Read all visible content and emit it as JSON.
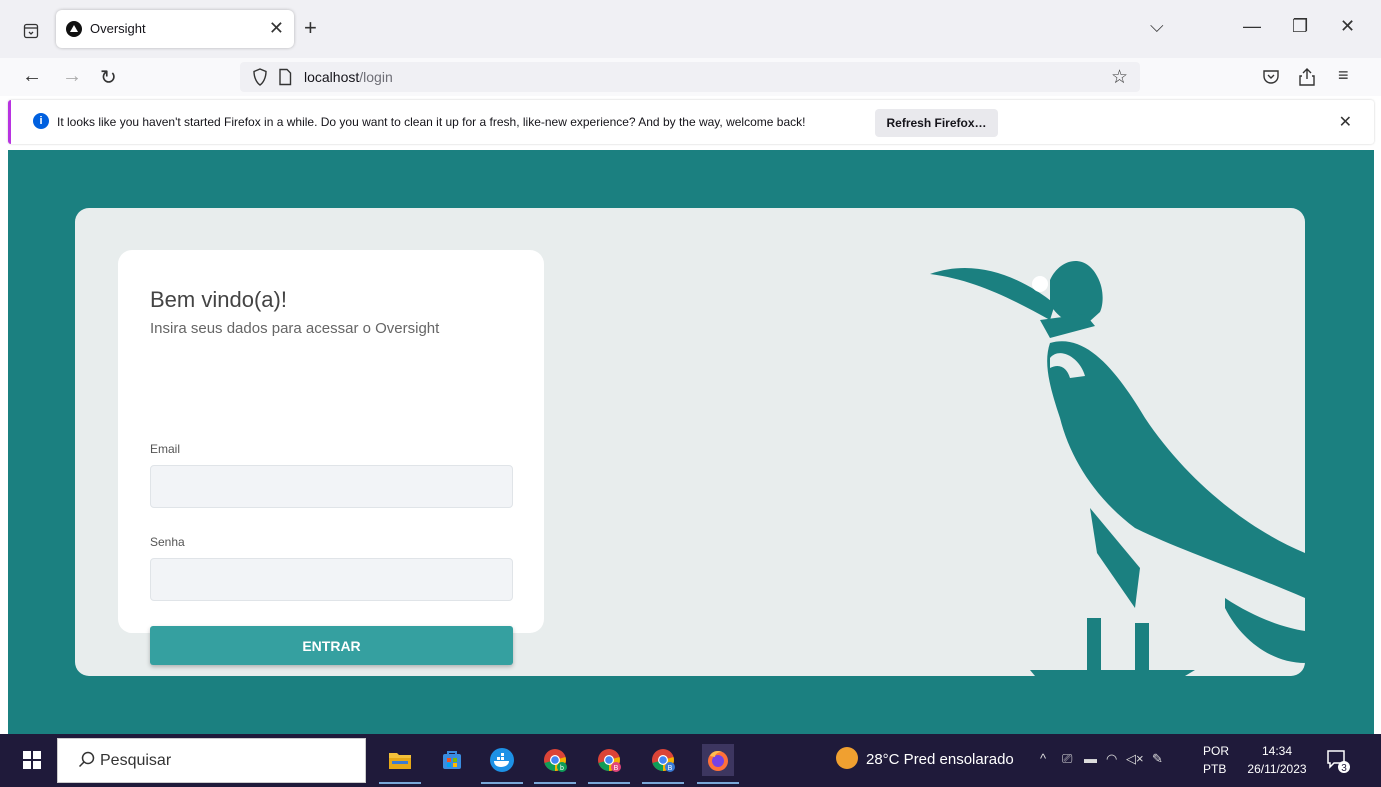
{
  "browser": {
    "tab": {
      "title": "Oversight"
    },
    "url": {
      "host": "localhost",
      "path": "/login"
    },
    "infobar": {
      "message": "It looks like you haven't started Firefox in a while. Do you want to clean it up for a fresh, like-new experience? And by the way, welcome back!",
      "button_label": "Refresh Firefox…"
    }
  },
  "login": {
    "title": "Bem vindo(a)!",
    "subtitle": "Insira seus dados para acessar o Oversight",
    "email_label": "Email",
    "password_label": "Senha",
    "submit_label": "ENTRAR"
  },
  "colors": {
    "page_bg": "#1b8080",
    "card_bg": "#e8eded",
    "button": "#35a0a0"
  },
  "taskbar": {
    "search_placeholder": "Pesquisar",
    "apps": [
      "file-explorer-icon",
      "store-icon",
      "docker-icon",
      "chrome-icon",
      "chrome-profile-icon",
      "chrome-profile-icon",
      "firefox-icon"
    ],
    "weather": "28°C  Pred ensolarado",
    "lang_top": "POR",
    "lang_bottom": "PTB",
    "time": "14:34",
    "date": "26/11/2023",
    "notifications": "3"
  }
}
